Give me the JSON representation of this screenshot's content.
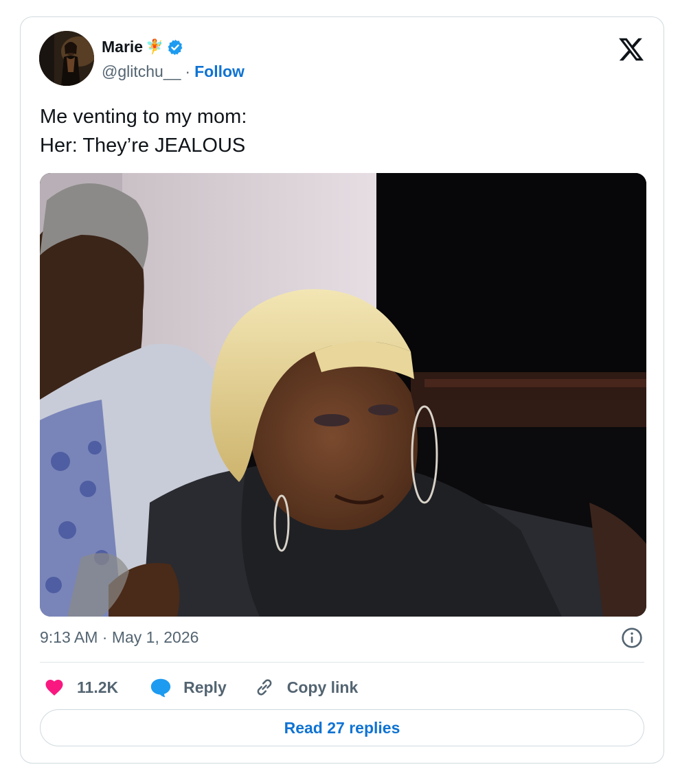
{
  "author": {
    "name": "Marie",
    "name_emoji": "🧚",
    "handle": "@glitchu__",
    "separator": "·",
    "follow_label": "Follow",
    "verified": true
  },
  "brand": {
    "logo": "x-logo-icon"
  },
  "tweet": {
    "lines": [
      "Me venting to my mom:",
      "Her: They’re JEALOUS"
    ]
  },
  "media": {
    "type": "photo"
  },
  "meta": {
    "timestamp": "9:13 AM · May 1, 2026"
  },
  "actions": {
    "like_count": "11.2K",
    "reply_label": "Reply",
    "copy_link_label": "Copy link"
  },
  "footer": {
    "read_replies_label": "Read 27 replies"
  },
  "colors": {
    "accent": "#0f73d3",
    "verified": "#1d9bf0",
    "like": "#f91880",
    "text_secondary": "#536471",
    "border": "#cfd9de"
  },
  "icons": [
    "verified-badge-icon",
    "x-logo-icon",
    "info-icon",
    "heart-icon",
    "reply-bubble-icon",
    "link-icon"
  ]
}
